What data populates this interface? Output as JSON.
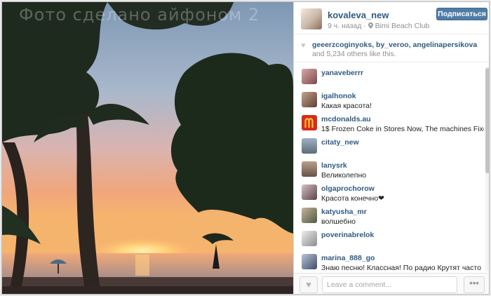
{
  "photo": {
    "watermark_text": "Фото сделано айфоном 2"
  },
  "header": {
    "username": "kovaleva_new",
    "time_ago": "9 ч. назад",
    "location": "Bimi Beach Club",
    "follow_label": "Подписаться"
  },
  "likes": {
    "names": "geeerzcoginyoks, by_veroo, angelinapersikova",
    "and_text": " and ",
    "count": "5,234",
    "suffix": " others like this."
  },
  "comments": [
    {
      "user": "yanaveberrr",
      "text": ""
    },
    {
      "user": "igalhonok",
      "text": "Какая красота!"
    },
    {
      "user": "mcdonalds.au",
      "text": "1$ Frozen Coke in Stores Now, The machines Fixed"
    },
    {
      "user": "citaty_new",
      "text": ""
    },
    {
      "user": "lanysrk",
      "text": "Великолепно"
    },
    {
      "user": "olgaprochorow",
      "text": "Красота конечно❤"
    },
    {
      "user": "katyusha_mr",
      "text": "волшебно"
    },
    {
      "user": "poverinabrelok",
      "text": ""
    },
    {
      "user": "marina_888_go",
      "text": "Знаю песню! Классная! По радио Крутят часто"
    }
  ],
  "footer": {
    "comment_placeholder": "Leave a comment...",
    "more_label": "•••"
  },
  "icons": {
    "location": "pin-icon",
    "likes": "heart-icon",
    "like_button": "heart-icon"
  },
  "colors": {
    "link": "#2f5a82",
    "follow_button": "#4f7ca6"
  }
}
